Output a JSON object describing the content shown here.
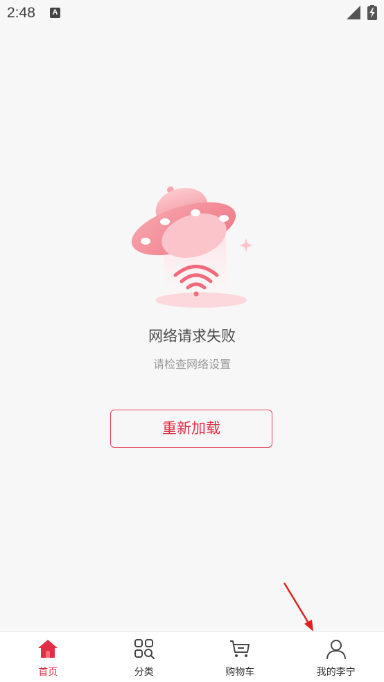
{
  "status_bar": {
    "time": "2:48",
    "notification_icon_letter": "A"
  },
  "error": {
    "title": "网络请求失败",
    "subtitle": "请检查网络设置",
    "reload_label": "重新加载"
  },
  "tab_bar": {
    "active_color": "#e02e46",
    "tabs": [
      {
        "label": "首页",
        "icon": "home-icon",
        "active": true
      },
      {
        "label": "分类",
        "icon": "category-grid-icon",
        "active": false
      },
      {
        "label": "购物车",
        "icon": "cart-icon",
        "active": false
      },
      {
        "label": "我的李宁",
        "icon": "user-icon",
        "active": false
      }
    ]
  }
}
